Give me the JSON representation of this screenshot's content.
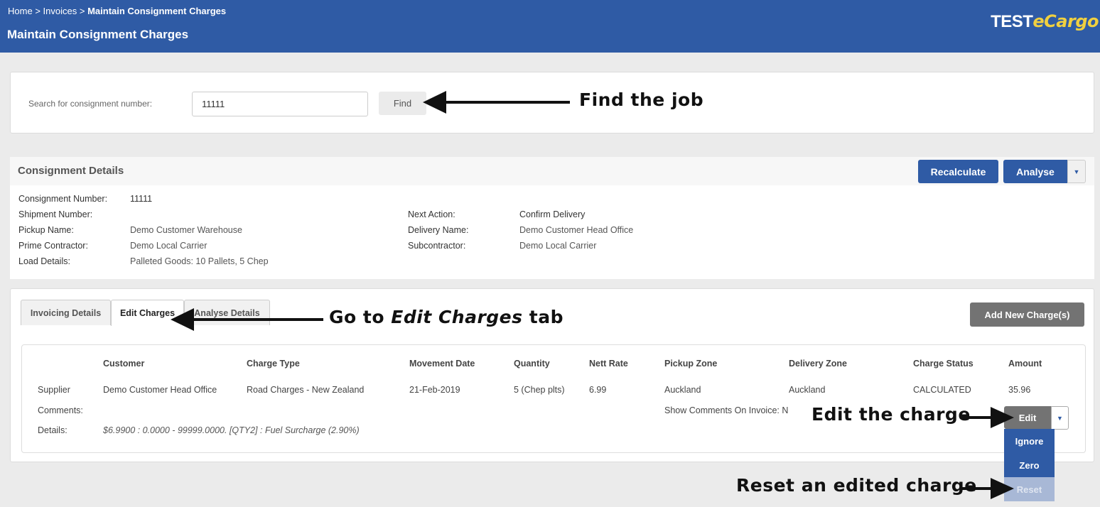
{
  "header": {
    "breadcrumb": {
      "home": "Home",
      "sep1": ">",
      "invoices": "Invoices",
      "sep2": ">",
      "current": "Maintain Consignment Charges"
    },
    "title": "Maintain Consignment Charges",
    "logo": {
      "prefix": "TEST",
      "brand": "eCargo"
    }
  },
  "search": {
    "label": "Search for consignment number:",
    "value": "11111",
    "find_label": "Find"
  },
  "consignment": {
    "title": "Consignment Details",
    "recalculate_label": "Recalculate",
    "analyse_label": "Analyse",
    "fields_left": [
      {
        "label": "Consignment Number:",
        "value": "11111"
      },
      {
        "label": "Shipment Number:",
        "value": ""
      },
      {
        "label": "Pickup Name:",
        "value": "Demo Customer Warehouse"
      },
      {
        "label": "Prime Contractor:",
        "value": "Demo Local Carrier"
      },
      {
        "label": "Load Details:",
        "value": "Palleted Goods: 10 Pallets, 5 Chep"
      }
    ],
    "fields_right": [
      {
        "label": "Next Action:",
        "value": "Confirm Delivery"
      },
      {
        "label": "Delivery Name:",
        "value": "Demo Customer Head Office"
      },
      {
        "label": "Subcontractor:",
        "value": "Demo Local Carrier"
      }
    ]
  },
  "tabs": [
    {
      "label": "Invoicing Details",
      "active": false
    },
    {
      "label": "Edit Charges",
      "active": true
    },
    {
      "label": "Analyse Details",
      "active": false
    }
  ],
  "add_charge_label": "Add New Charge(s)",
  "charges": {
    "headers": [
      "Customer",
      "Charge Type",
      "Movement Date",
      "Quantity",
      "Nett Rate",
      "Pickup Zone",
      "Delivery Zone",
      "Charge Status",
      "Amount"
    ],
    "row": {
      "role": "Supplier",
      "customer": "Demo Customer Head Office",
      "charge_type": "Road Charges - New Zealand",
      "movement_date": "21-Feb-2019",
      "quantity": "5 (Chep plts)",
      "nett_rate": "6.99",
      "pickup_zone": "Auckland",
      "delivery_zone": "Auckland",
      "charge_status": "CALCULATED",
      "amount": "35.96"
    },
    "comments_label": "Comments:",
    "show_comments": "Show Comments On Invoice: N",
    "details_label": "Details:",
    "details_value": "$6.9900 : 0.0000 - 99999.0000. [QTY2] : Fuel Surcharge (2.90%)"
  },
  "edit_menu": {
    "edit_label": "Edit",
    "items": [
      {
        "label": "Ignore",
        "disabled": false
      },
      {
        "label": "Zero",
        "disabled": false
      },
      {
        "label": "Reset",
        "disabled": true
      }
    ]
  },
  "annotations": {
    "find": "Find the job",
    "tab_prefix": "Go to",
    "tab_em": "Edit Charges",
    "tab_suffix": "tab",
    "edit": "Edit the charge",
    "reset": "Reset an edited charge"
  },
  "colors": {
    "header_bg": "#2f5ba5",
    "primary": "#2f5ba5",
    "secondary": "#737373",
    "logo_accent": "#f0d040"
  }
}
